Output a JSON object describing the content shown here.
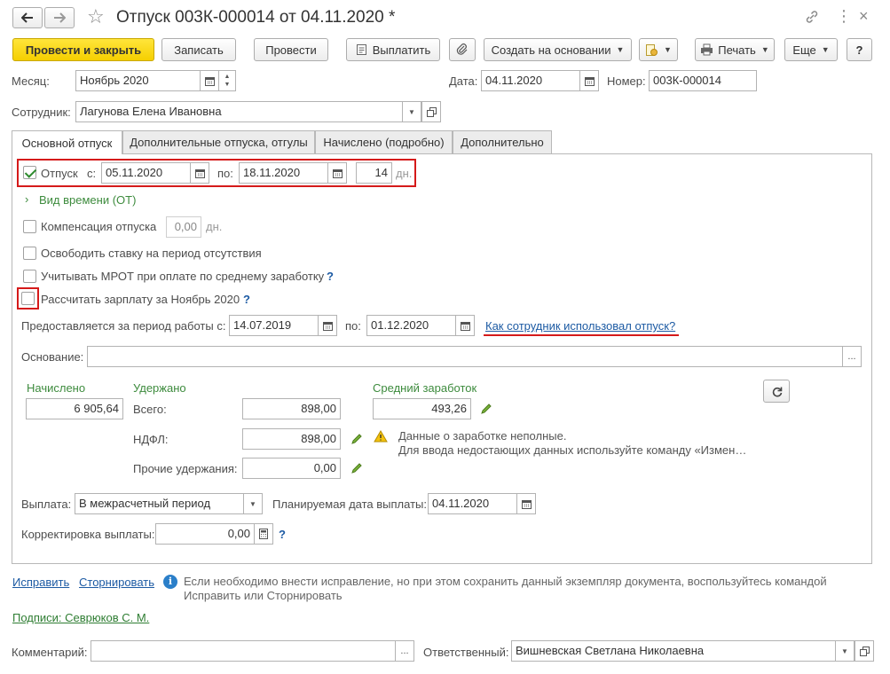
{
  "window": {
    "title": "Отпуск 003К-000014 от 04.11.2020 *"
  },
  "toolbar": {
    "post_close": "Провести и закрыть",
    "save": "Записать",
    "post": "Провести",
    "pay": "Выплатить",
    "create_based": "Создать на основании",
    "print": "Печать",
    "more": "Еще",
    "help": "?"
  },
  "header": {
    "month_label": "Месяц:",
    "month_value": "Ноябрь 2020",
    "date_label": "Дата:",
    "date_value": "04.11.2020",
    "number_label": "Номер:",
    "number_value": "003К-000014",
    "employee_label": "Сотрудник:",
    "employee_value": "Лагунова Елена Ивановна"
  },
  "tabs": [
    {
      "label": "Основной отпуск",
      "active": true
    },
    {
      "label": "Дополнительные отпуска, отгулы",
      "active": false
    },
    {
      "label": "Начислено (подробно)",
      "active": false
    },
    {
      "label": "Дополнительно",
      "active": false
    }
  ],
  "vacation": {
    "checkbox_label": "Отпуск",
    "checked": true,
    "from_label": "с:",
    "from_value": "05.11.2020",
    "to_label": "по:",
    "to_value": "18.11.2020",
    "days_value": "14",
    "days_unit": "дн.",
    "time_type_link": "Вид времени (ОТ)"
  },
  "options": {
    "compensation_label": "Компенсация отпуска",
    "compensation_value": "0,00",
    "compensation_unit": "дн.",
    "release_rate_label": "Освободить ставку на период отсутствия",
    "mrot_label": "Учитывать МРОТ при оплате по среднему заработку",
    "calc_salary_label": "Рассчитать зарплату за Ноябрь 2020"
  },
  "period": {
    "label": "Предоставляется за период работы с:",
    "from_value": "14.07.2019",
    "to_label": "по:",
    "to_value": "01.12.2020",
    "usage_link": "Как сотрудник использовал отпуск?"
  },
  "basis": {
    "label": "Основание:",
    "value": "",
    "btn": "..."
  },
  "totals": {
    "accrued_label": "Начислено",
    "accrued_value": "6 905,64",
    "withheld_label": "Удержано",
    "total_label": "Всего:",
    "total_value": "898,00",
    "ndfl_label": "НДФЛ:",
    "ndfl_value": "898,00",
    "other_label": "Прочие удержания:",
    "other_value": "0,00",
    "avg_label": "Средний заработок",
    "avg_value": "493,26",
    "warning_line1": "Данные о заработке неполные.",
    "warning_line2": "Для ввода недостающих данных используйте команду «Измен…"
  },
  "payment": {
    "label": "Выплата:",
    "value": "В межрасчетный период",
    "planned_label": "Планируемая дата выплаты:",
    "planned_value": "04.11.2020",
    "correction_label": "Корректировка выплаты:",
    "correction_value": "0,00"
  },
  "footer": {
    "fix_link": "Исправить",
    "storno_link": "Сторнировать",
    "info_line1": "Если необходимо внести исправление, но при этом сохранить данный экземпляр документа, воспользуйтесь командой",
    "info_line2": "Исправить или Сторнировать",
    "signatures_link": "Подписи: Севрюков С. М.",
    "comment_label": "Комментарий:",
    "comment_value": "",
    "responsible_label": "Ответственный:",
    "responsible_value": "Вишневская Светлана Николаевна"
  },
  "colors": {
    "accent_yellow": "#f5cf00",
    "highlight_red": "#d51a1a",
    "link_blue": "#1c5aa3",
    "green_label": "#3d8b3d"
  }
}
